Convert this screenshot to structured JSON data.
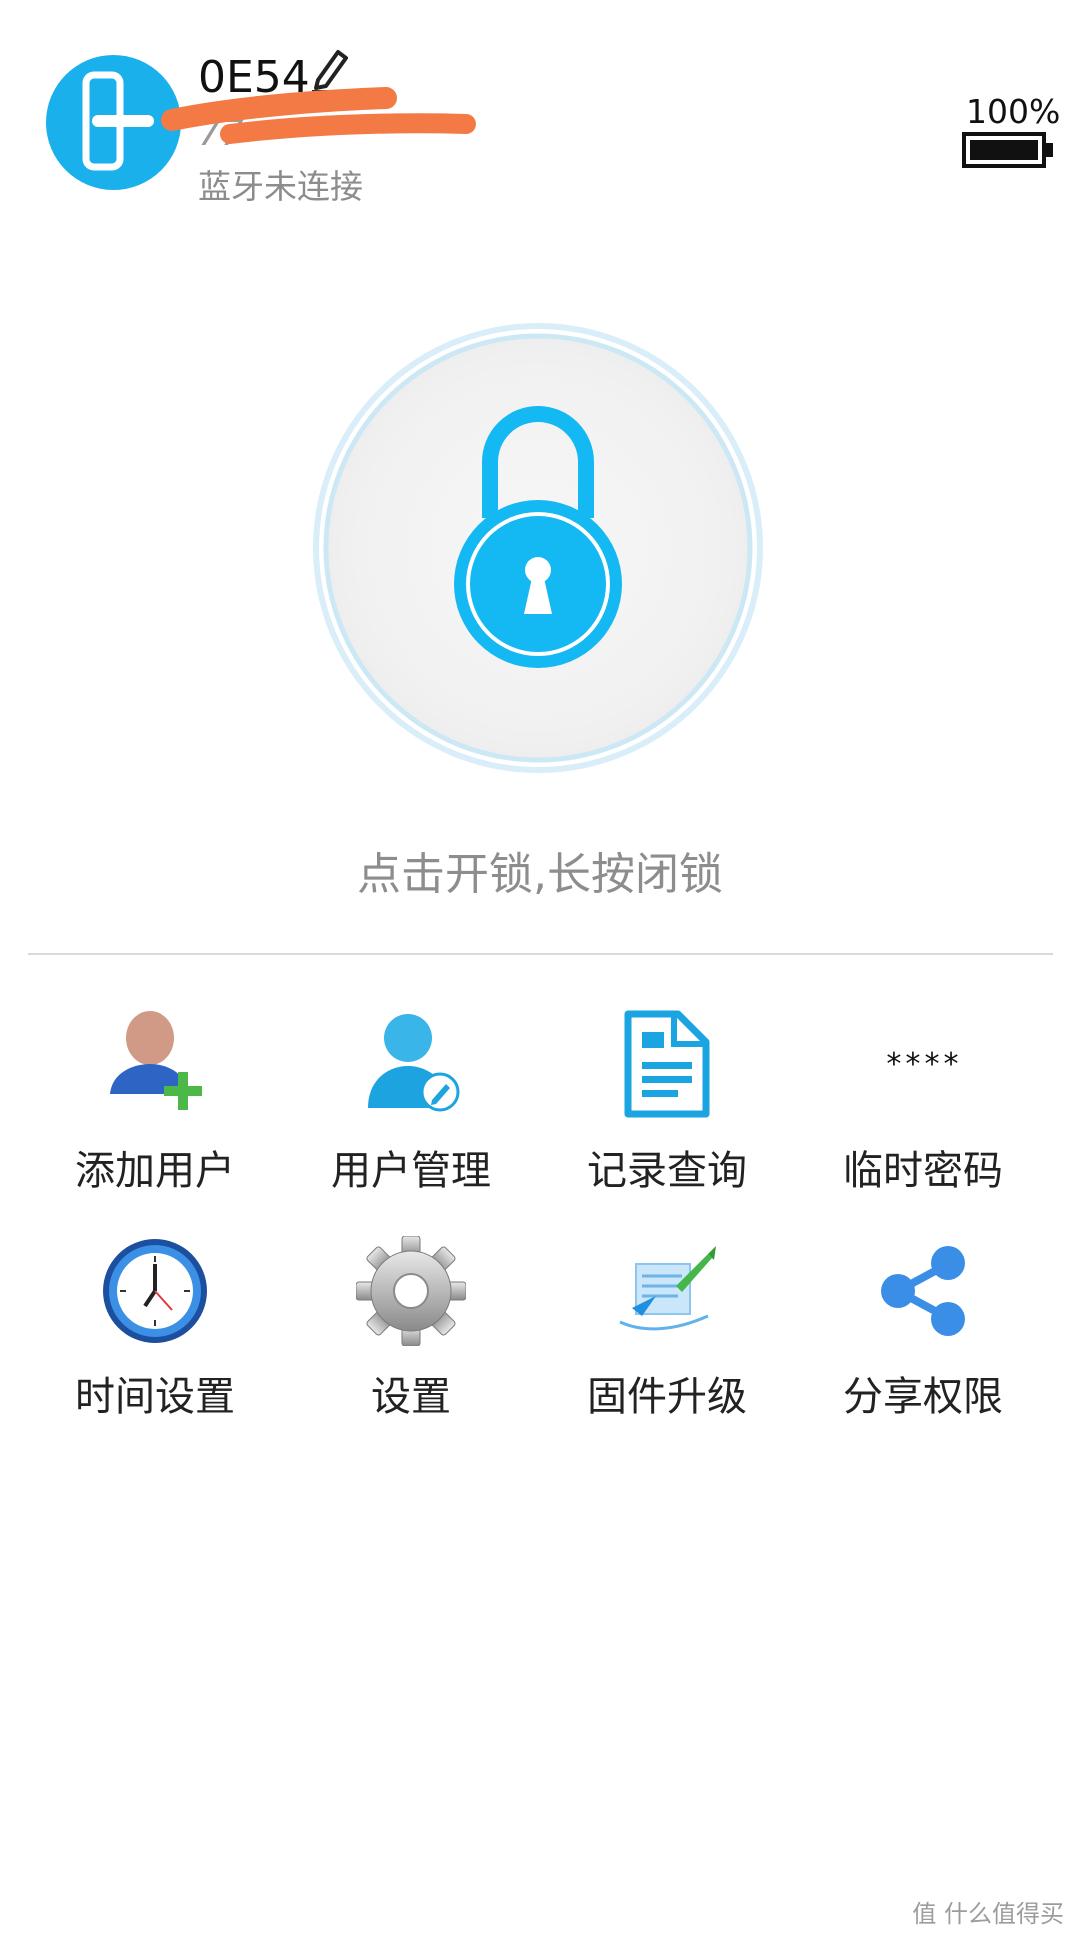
{
  "header": {
    "device_name": "0E54",
    "device_id": "77",
    "bluetooth_status": "蓝牙未连接",
    "battery_percent": "100%",
    "battery_level": 1.0
  },
  "main": {
    "hint": "点击开锁,长按闭锁"
  },
  "grid": [
    {
      "label": "添加用户",
      "icon": "add-user-icon"
    },
    {
      "label": "用户管理",
      "icon": "user-manage-icon"
    },
    {
      "label": "记录查询",
      "icon": "record-document-icon"
    },
    {
      "label": "临时密码",
      "icon": "password-asterisk-icon"
    },
    {
      "label": "时间设置",
      "icon": "clock-icon"
    },
    {
      "label": "设置",
      "icon": "gear-icon"
    },
    {
      "label": "固件升级",
      "icon": "rocket-upgrade-icon"
    },
    {
      "label": "分享权限",
      "icon": "share-icon"
    }
  ],
  "temp_password_glyph": "****",
  "watermark": "值 什么值得买",
  "colors": {
    "accent": "#1ab0ec",
    "redact": "#f47a45"
  }
}
